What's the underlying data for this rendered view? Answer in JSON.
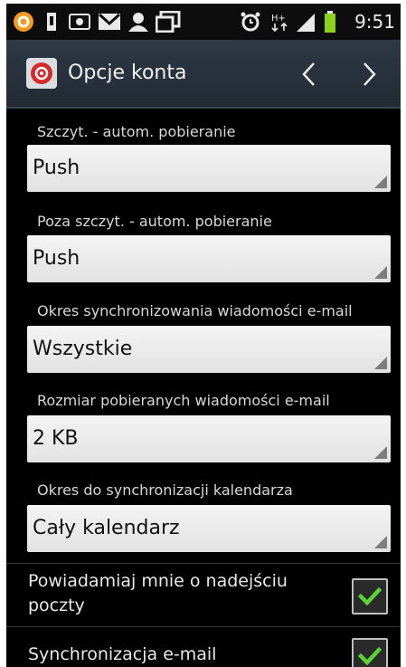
{
  "statusbar": {
    "time": "9:51",
    "icons": [
      "notification-circle-icon",
      "sd-card-icon",
      "image-icon",
      "gmail-icon",
      "contact-icon",
      "window-icon",
      "alarm-icon",
      "hplus-data-icon",
      "signal-icon",
      "battery-icon"
    ]
  },
  "actionbar": {
    "title": "Opcje konta",
    "prev_icon": "chevron-left-icon",
    "next_icon": "chevron-right-icon"
  },
  "settings": [
    {
      "label": "Szczyt. - autom. pobieranie",
      "value": "Push"
    },
    {
      "label": "Poza szczyt. - autom. pobieranie",
      "value": "Push"
    },
    {
      "label": "Okres synchronizowania wiadomości e-mail",
      "value": "Wszystkie"
    },
    {
      "label": "Rozmiar pobieranych wiadomości e-mail",
      "value": "2 KB"
    },
    {
      "label": "Okres do synchronizacji kalendarza",
      "value": "Cały kalendarz"
    }
  ],
  "checks": [
    {
      "label": "Powiadamiaj mnie o nadejściu poczty",
      "checked": true
    },
    {
      "label": "Synchronizacja e-mail",
      "checked": true
    }
  ],
  "colors": {
    "accent_check": "#5cd23a",
    "actionbar": "#2e3946",
    "dropdown": "#e8e8e8"
  }
}
